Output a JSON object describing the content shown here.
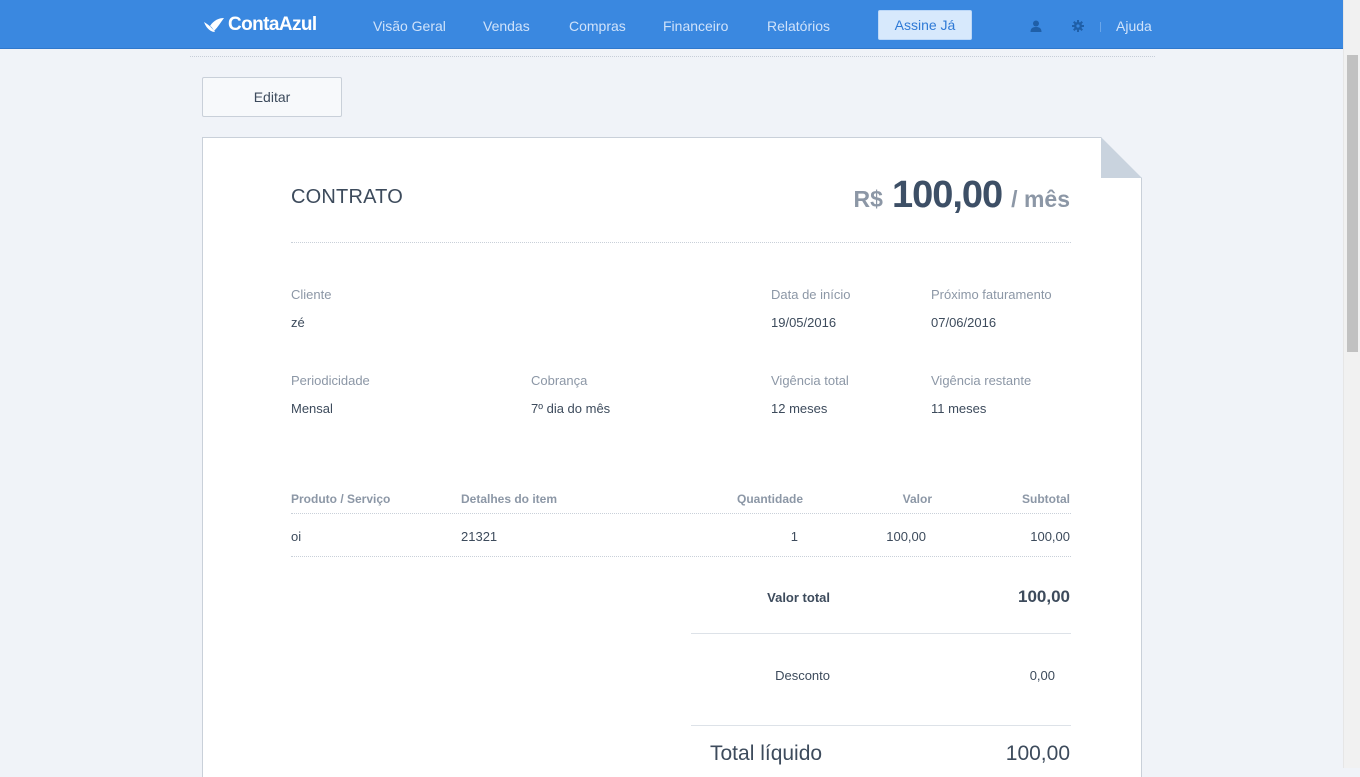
{
  "app": {
    "logo_text": "ContaAzul"
  },
  "nav": {
    "items": [
      {
        "label": "Visão Geral"
      },
      {
        "label": "Vendas"
      },
      {
        "label": "Compras"
      },
      {
        "label": "Financeiro"
      },
      {
        "label": "Relatórios"
      }
    ],
    "cta_label": "Assine Já",
    "help_label": "Ajuda"
  },
  "toolbar": {
    "edit_label": "Editar"
  },
  "contract": {
    "title": "CONTRATO",
    "price": {
      "currency": "R$",
      "amount": "100,00",
      "period": "/ mês"
    },
    "fields": {
      "cliente": {
        "label": "Cliente",
        "value": "zé"
      },
      "data_inicio": {
        "label": "Data de início",
        "value": "19/05/2016"
      },
      "proximo_faturamento": {
        "label": "Próximo faturamento",
        "value": "07/06/2016"
      },
      "periodicidade": {
        "label": "Periodicidade",
        "value": "Mensal"
      },
      "cobranca": {
        "label": "Cobrança",
        "value": "7º dia do mês"
      },
      "vigencia_total": {
        "label": "Vigência total",
        "value": "12 meses"
      },
      "vigencia_restante": {
        "label": "Vigência restante",
        "value": "11 meses"
      }
    },
    "items_table": {
      "headers": [
        "Produto / Serviço",
        "Detalhes do item",
        "Quantidade",
        "Valor",
        "Subtotal"
      ],
      "rows": [
        [
          "oi",
          "21321",
          "1",
          "100,00",
          "100,00"
        ]
      ]
    },
    "totals": {
      "valor_total": {
        "label": "Valor total",
        "value": "100,00"
      },
      "desconto": {
        "label": "Desconto",
        "value": "0,00"
      },
      "total_liquido": {
        "label": "Total líquido",
        "value": "100,00"
      }
    }
  },
  "colors": {
    "topbar": "#3a88e0",
    "cta_bg": "#d7e9fc",
    "page_bg": "#f0f3f8",
    "text": "#3d4b5c",
    "muted": "#8c97a6"
  }
}
